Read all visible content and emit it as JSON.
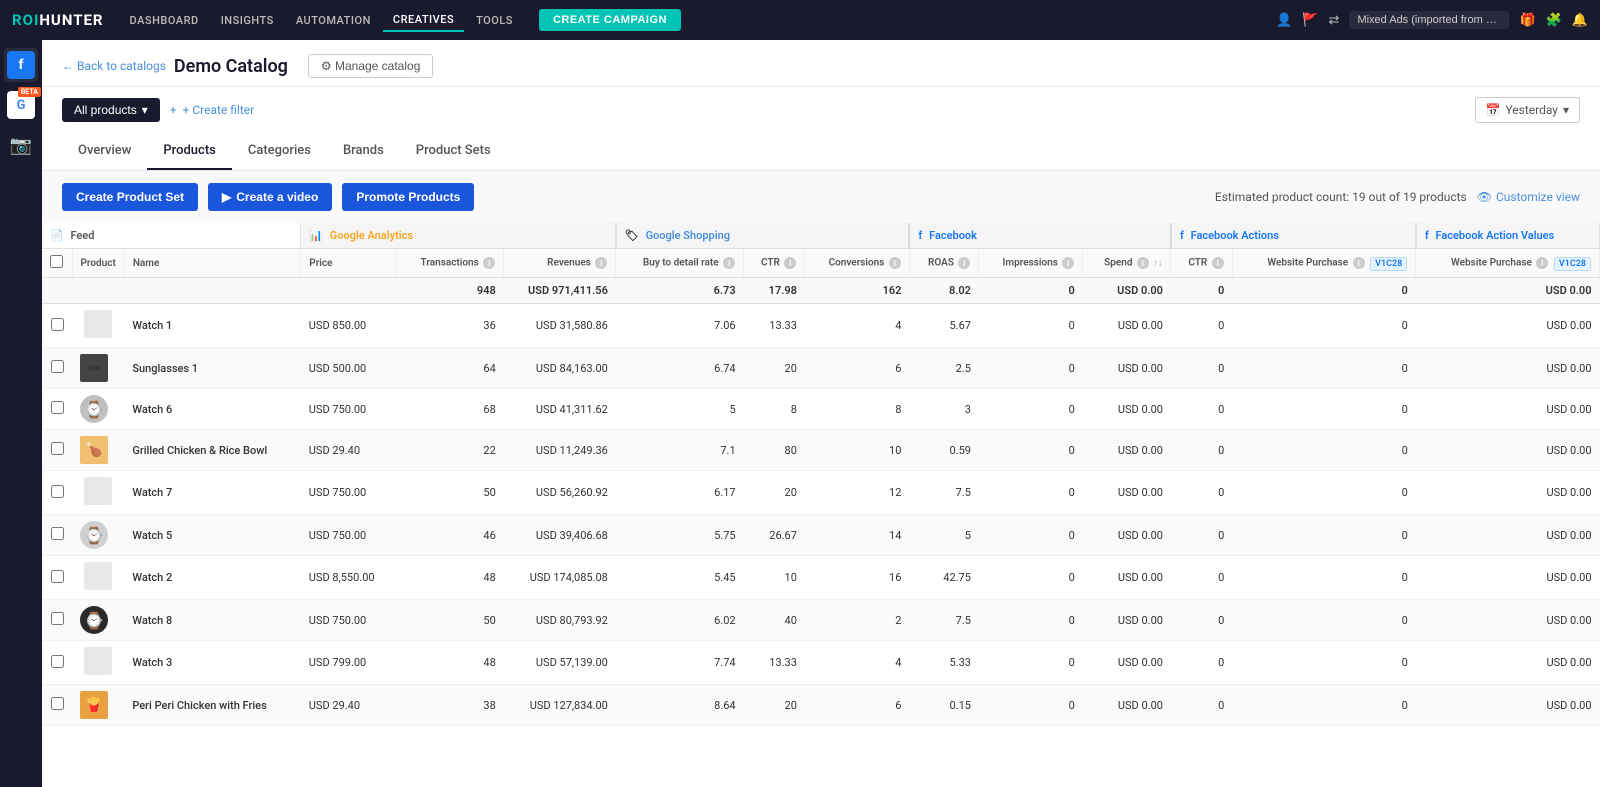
{
  "nav": {
    "logo_roi": "ROI",
    "logo_hunter": "HUNTER",
    "links": [
      "DASHBOARD",
      "INSIGHTS",
      "AUTOMATION",
      "CREATIVES",
      "TOOLS"
    ],
    "create_btn": "CREATE CAMPAIGN",
    "store_label": "Mixed Ads (imported from Faceb...",
    "active_link": "CREATIVES"
  },
  "sidebar": {
    "icons": [
      "facebook",
      "google",
      "camera"
    ]
  },
  "header": {
    "back_label": "← Back to catalogs",
    "catalog_title": "Demo Catalog",
    "manage_btn": "⚙ Manage catalog"
  },
  "filters": {
    "all_products": "All products",
    "create_filter": "+ Create filter",
    "date_label": "Yesterday"
  },
  "tabs": {
    "items": [
      "Overview",
      "Products",
      "Categories",
      "Brands",
      "Product Sets"
    ],
    "active": "Products"
  },
  "actions": {
    "create_product_set": "Create Product Set",
    "create_video": "Create a video",
    "promote_products": "Promote Products",
    "estimated_count": "Estimated product count: 19 out of 19 products",
    "customize_view": "Customize view"
  },
  "table": {
    "sections": {
      "feed": "Feed",
      "ga": "Google Analytics",
      "gs": "Google Shopping",
      "fb": "Facebook",
      "fba": "Facebook Actions",
      "fbav": "Facebook Action Values"
    },
    "columns": {
      "product": "Product",
      "name": "Name",
      "price": "Price",
      "transactions": "Transactions",
      "revenues": "Revenues",
      "buy_to_detail": "Buy to detail rate",
      "ctr_gs": "CTR",
      "conversions": "Conversions",
      "roas": "ROAS",
      "impressions": "Impressions",
      "spend": "Spend",
      "ctr_fb": "CTR",
      "website_purchase": "Website Purchase",
      "website_purchase_val": "Website Purchase"
    },
    "totals": {
      "transactions": "948",
      "revenues": "USD 971,411.56",
      "buy_to_detail": "6.73",
      "ctr_gs": "17.98",
      "conversions": "162",
      "roas": "8.02",
      "impressions": "0",
      "spend": "USD 0.00",
      "ctr_fb": "0",
      "website_purchase": "0",
      "website_purchase_val": "USD 0.00"
    },
    "rows": [
      {
        "id": 1,
        "thumb_type": "none",
        "name": "Watch 1",
        "price": "USD 850.00",
        "transactions": "36",
        "revenues": "USD 31,580.86",
        "buy_to_detail": "7.06",
        "ctr_gs": "13.33",
        "conversions": "4",
        "roas": "5.67",
        "impressions": "0",
        "spend": "USD 0.00",
        "ctr_fb": "0",
        "website_purchase": "0",
        "website_purchase_val": "USD 0.00"
      },
      {
        "id": 2,
        "thumb_type": "glasses",
        "name": "Sunglasses 1",
        "price": "USD 500.00",
        "transactions": "64",
        "revenues": "USD 84,163.00",
        "buy_to_detail": "6.74",
        "ctr_gs": "20",
        "conversions": "6",
        "roas": "2.5",
        "impressions": "0",
        "spend": "USD 0.00",
        "ctr_fb": "0",
        "website_purchase": "0",
        "website_purchase_val": "USD 0.00"
      },
      {
        "id": 3,
        "thumb_type": "watch",
        "name": "Watch 6",
        "price": "USD 750.00",
        "transactions": "68",
        "revenues": "USD 41,311.62",
        "buy_to_detail": "5",
        "ctr_gs": "8",
        "conversions": "8",
        "roas": "3",
        "impressions": "0",
        "spend": "USD 0.00",
        "ctr_fb": "0",
        "website_purchase": "0",
        "website_purchase_val": "USD 0.00"
      },
      {
        "id": 4,
        "thumb_type": "food",
        "name": "Grilled Chicken & Rice Bowl",
        "price": "USD 29.40",
        "transactions": "22",
        "revenues": "USD 11,249.36",
        "buy_to_detail": "7.1",
        "ctr_gs": "80",
        "conversions": "10",
        "roas": "0.59",
        "impressions": "0",
        "spend": "USD 0.00",
        "ctr_fb": "0",
        "website_purchase": "0",
        "website_purchase_val": "USD 0.00"
      },
      {
        "id": 5,
        "thumb_type": "none",
        "name": "Watch 7",
        "price": "USD 750.00",
        "transactions": "50",
        "revenues": "USD 56,260.92",
        "buy_to_detail": "6.17",
        "ctr_gs": "20",
        "conversions": "12",
        "roas": "7.5",
        "impressions": "0",
        "spend": "USD 0.00",
        "ctr_fb": "0",
        "website_purchase": "0",
        "website_purchase_val": "USD 0.00"
      },
      {
        "id": 6,
        "thumb_type": "watch_light",
        "name": "Watch 5",
        "price": "USD 750.00",
        "transactions": "46",
        "revenues": "USD 39,406.68",
        "buy_to_detail": "5.75",
        "ctr_gs": "26.67",
        "conversions": "14",
        "roas": "5",
        "impressions": "0",
        "spend": "USD 0.00",
        "ctr_fb": "0",
        "website_purchase": "0",
        "website_purchase_val": "USD 0.00"
      },
      {
        "id": 7,
        "thumb_type": "none",
        "name": "Watch 2",
        "price": "USD 8,550.00",
        "transactions": "48",
        "revenues": "USD 174,085.08",
        "buy_to_detail": "5.45",
        "ctr_gs": "10",
        "conversions": "16",
        "roas": "42.75",
        "impressions": "0",
        "spend": "USD 0.00",
        "ctr_fb": "0",
        "website_purchase": "0",
        "website_purchase_val": "USD 0.00"
      },
      {
        "id": 8,
        "thumb_type": "watch_dark",
        "name": "Watch 8",
        "price": "USD 750.00",
        "transactions": "50",
        "revenues": "USD 80,793.92",
        "buy_to_detail": "6.02",
        "ctr_gs": "40",
        "conversions": "2",
        "roas": "7.5",
        "impressions": "0",
        "spend": "USD 0.00",
        "ctr_fb": "0",
        "website_purchase": "0",
        "website_purchase_val": "USD 0.00"
      },
      {
        "id": 9,
        "thumb_type": "none",
        "name": "Watch 3",
        "price": "USD 799.00",
        "transactions": "48",
        "revenues": "USD 57,139.00",
        "buy_to_detail": "7.74",
        "ctr_gs": "13.33",
        "conversions": "4",
        "roas": "5.33",
        "impressions": "0",
        "spend": "USD 0.00",
        "ctr_fb": "0",
        "website_purchase": "0",
        "website_purchase_val": "USD 0.00"
      },
      {
        "id": 10,
        "thumb_type": "food2",
        "name": "Peri Peri Chicken with Fries",
        "price": "USD 29.40",
        "transactions": "38",
        "revenues": "USD 127,834.00",
        "buy_to_detail": "8.64",
        "ctr_gs": "20",
        "conversions": "6",
        "roas": "0.15",
        "impressions": "0",
        "spend": "USD 0.00",
        "ctr_fb": "0",
        "website_purchase": "0",
        "website_purchase_val": "USD 0.00"
      }
    ]
  },
  "colors": {
    "primary_dark": "#1a1a2e",
    "accent_teal": "#00c4b4",
    "blue_btn": "#1a56db",
    "fb_blue": "#1877f2",
    "ga_orange": "#f5a623",
    "gs_blue": "#4a90d9"
  }
}
